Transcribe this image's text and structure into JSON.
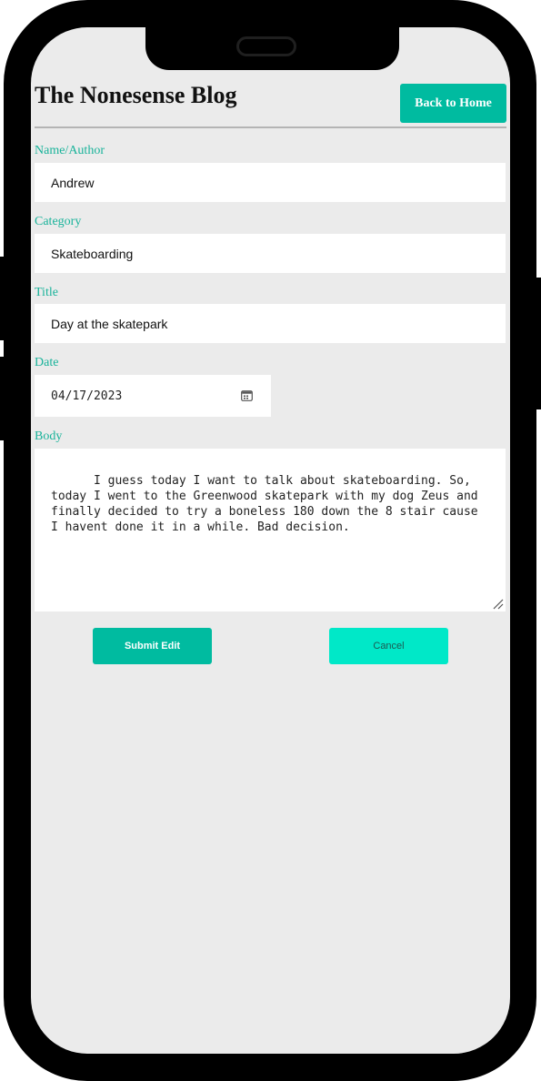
{
  "header": {
    "title": "The Nonesense Blog",
    "back_label": "Back to Home"
  },
  "form": {
    "author_label": "Name/Author",
    "author_value": "Andrew",
    "category_label": "Category",
    "category_value": "Skateboarding",
    "title_label": "Title",
    "title_value": "Day at the skatepark",
    "date_label": "Date",
    "date_value": "04/17/2023",
    "body_label": "Body",
    "body_value": "I guess today I want to talk about skateboarding. So, today I went to the Greenwood skatepark with my dog Zeus and finally decided to try a boneless 180 down the 8 stair cause I havent done it in a while. Bad decision."
  },
  "actions": {
    "submit_label": "Submit Edit",
    "cancel_label": "Cancel"
  },
  "colors": {
    "accent": "#00bba0",
    "accent_light": "#00e8c8",
    "label": "#19b39a",
    "background": "#ebebeb"
  },
  "icons": {
    "date": "calendar-icon",
    "textarea": "resize-handle-icon"
  }
}
